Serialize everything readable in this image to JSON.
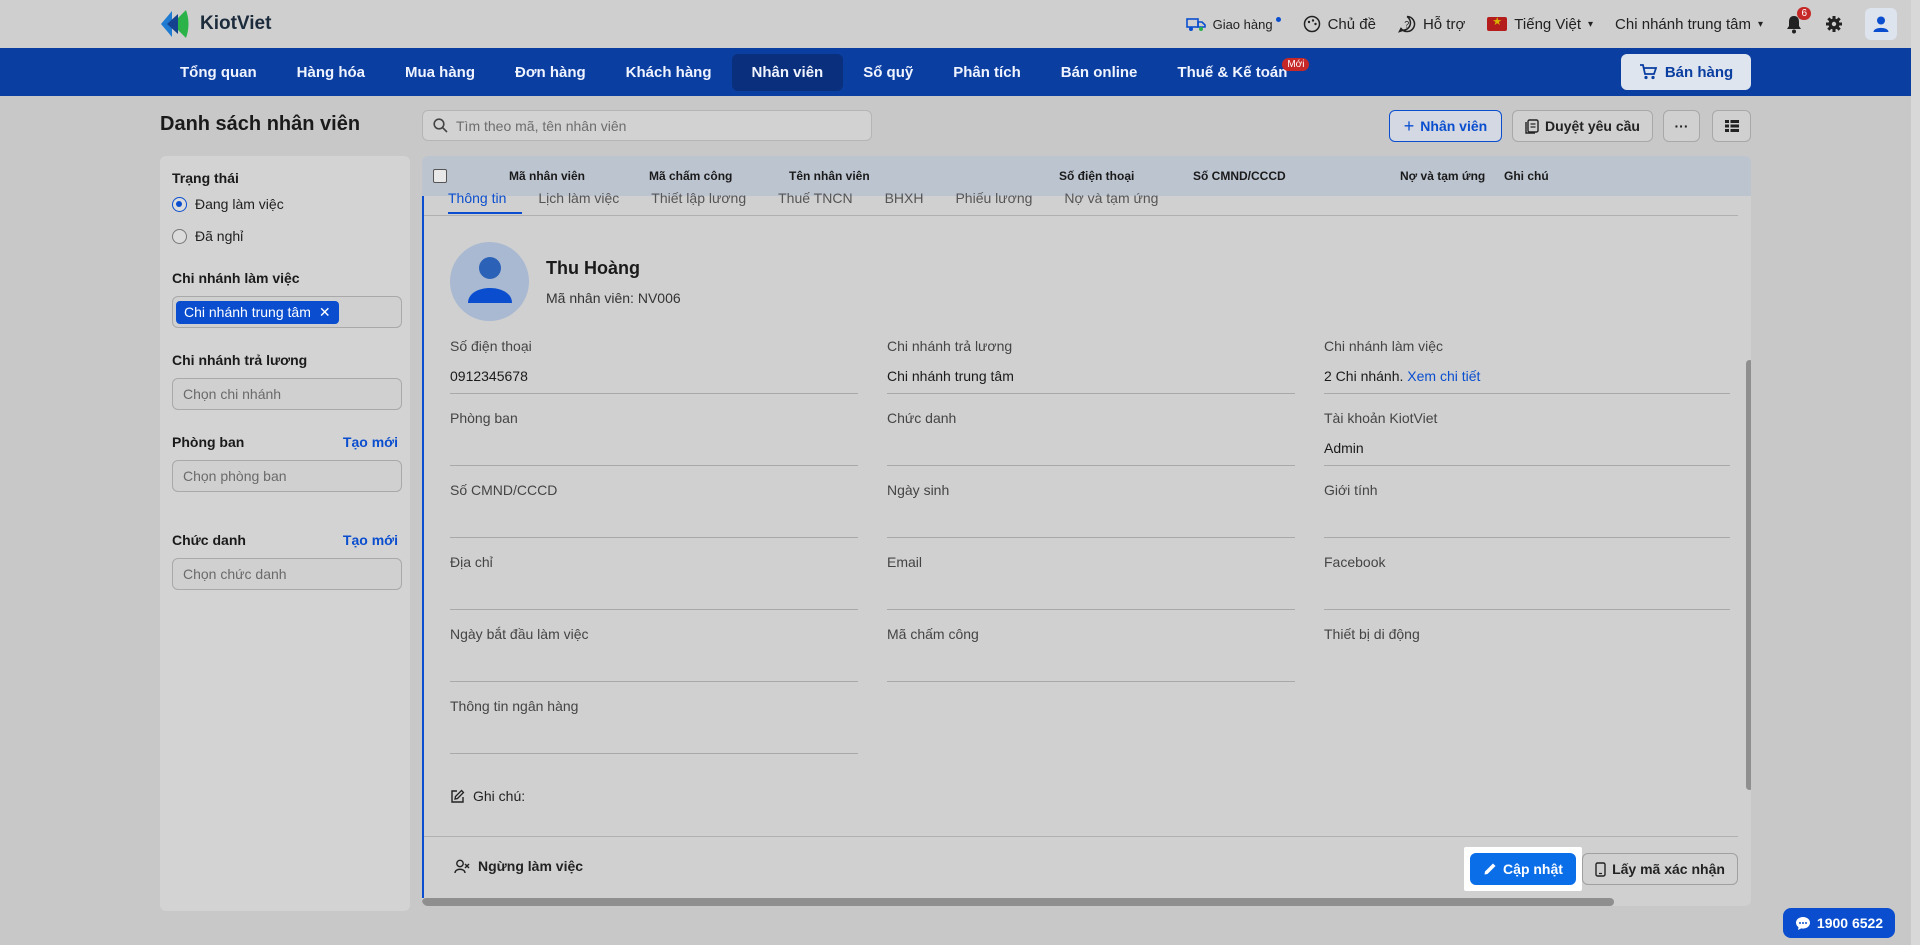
{
  "app": {
    "name": "KiotViet"
  },
  "topbar": {
    "delivery": "Giao hàng",
    "theme": "Chủ đề",
    "support": "Hỗ trợ",
    "language": "Tiếng Việt",
    "branch": "Chi nhánh trung tâm",
    "notification_count": "6"
  },
  "nav": {
    "items": [
      "Tổng quan",
      "Hàng hóa",
      "Mua hàng",
      "Đơn hàng",
      "Khách hàng",
      "Nhân viên",
      "Sổ quỹ",
      "Phân tích",
      "Bán online",
      "Thuế & Kế toán"
    ],
    "new_badge": "Mới",
    "sell_button": "Bán hàng"
  },
  "page": {
    "title": "Danh sách nhân viên",
    "search_placeholder": "Tìm theo mã, tên nhân viên",
    "add_employee": "Nhân viên",
    "approve_requests": "Duyệt yêu cầu",
    "more": "···"
  },
  "filters": {
    "status_label": "Trạng thái",
    "status_working": "Đang làm việc",
    "status_quit": "Đã nghỉ",
    "work_branch_label": "Chi nhánh làm việc",
    "work_branch_chip": "Chi nhánh trung tâm",
    "pay_branch_label": "Chi nhánh trả lương",
    "pay_branch_placeholder": "Chọn chi nhánh",
    "department_label": "Phòng ban",
    "department_create": "Tạo mới",
    "department_placeholder": "Chọn phòng ban",
    "title_label": "Chức danh",
    "title_create": "Tạo mới",
    "title_placeholder": "Chọn chức danh"
  },
  "table": {
    "columns": [
      "Mã nhân viên",
      "Mã chấm công",
      "Tên nhân viên",
      "Số điện thoại",
      "Số CMND/CCCD",
      "Nợ và tạm ứng",
      "Ghi chú"
    ]
  },
  "detail": {
    "tabs": [
      "Thông tin",
      "Lịch làm việc",
      "Thiết lập lương",
      "Thuế TNCN",
      "BHXH",
      "Phiếu lương",
      "Nợ và tạm ứng"
    ],
    "name": "Thu Hoàng",
    "code": "Mã nhân viên: NV006",
    "fields": {
      "phone_label": "Số điện thoại",
      "phone_value": "0912345678",
      "pay_branch_label": "Chi nhánh trả lương",
      "pay_branch_value": "Chi nhánh trung tâm",
      "work_branch_label": "Chi nhánh làm việc",
      "work_branch_value": "2 Chi nhánh.",
      "work_branch_link": "Xem chi tiết",
      "department_label": "Phòng ban",
      "position_label": "Chức danh",
      "account_label": "Tài khoản KiotViet",
      "account_value": "Admin",
      "id_label": "Số CMND/CCCD",
      "dob_label": "Ngày sinh",
      "gender_label": "Giới tính",
      "address_label": "Địa chỉ",
      "email_label": "Email",
      "facebook_label": "Facebook",
      "start_date_label": "Ngày bắt đầu làm việc",
      "timecard_label": "Mã chấm công",
      "device_label": "Thiết bị di động",
      "bank_label": "Thông tin ngân hàng"
    },
    "note_label": "Ghi chú:",
    "stop_working": "Ngừng làm việc",
    "update": "Cập nhật",
    "get_code": "Lấy mã xác nhận"
  },
  "hotline": "1900 6522",
  "colors": {
    "primary": "#0a3ea1",
    "accent": "#0a4ecf",
    "update_button": "#0a6ee9"
  }
}
